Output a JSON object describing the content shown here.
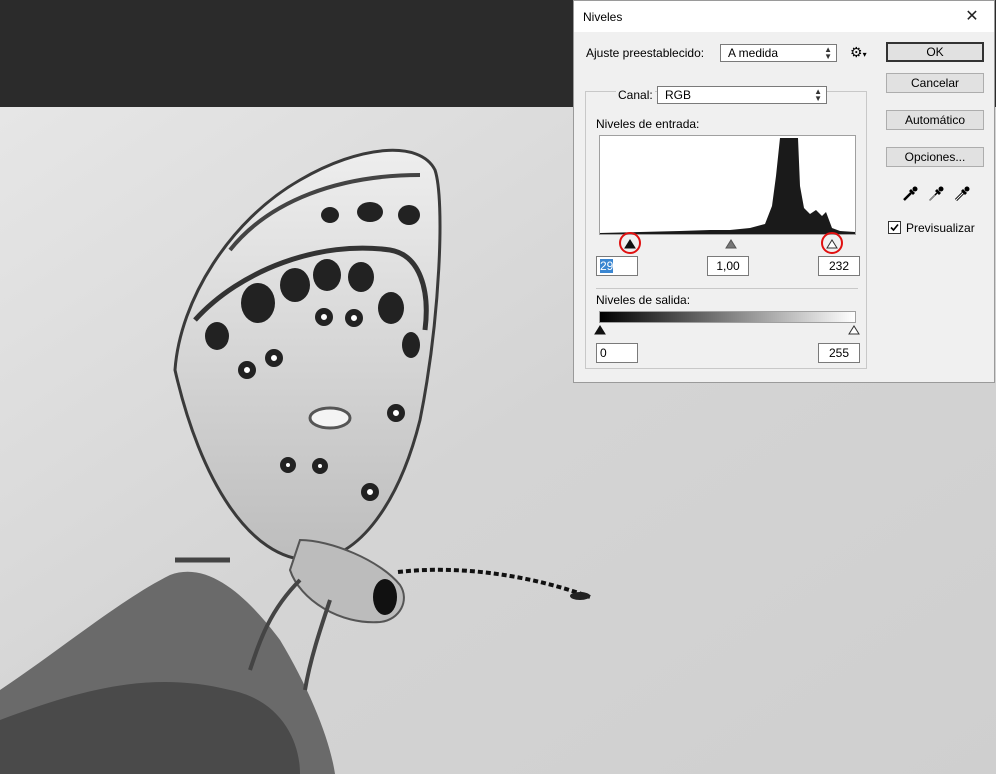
{
  "dialog": {
    "title": "Niveles",
    "preset_label": "Ajuste preestablecido:",
    "preset_value": "A medida",
    "settings_icon": "gear-icon",
    "channel_label": "Canal:",
    "channel_value": "RGB",
    "input_levels_label": "Niveles de entrada:",
    "input_black": "29",
    "input_gamma": "1,00",
    "input_white": "232",
    "input_black_level": 29,
    "input_white_level": 232,
    "output_levels_label": "Niveles de salida:",
    "output_black": "0",
    "output_white": "255",
    "output_black_level": 0,
    "output_white_level": 255,
    "buttons": {
      "ok": "OK",
      "cancel": "Cancelar",
      "auto": "Automático",
      "options": "Opciones..."
    },
    "eyedroppers": [
      "black-eyedropper-icon",
      "gray-eyedropper-icon",
      "white-eyedropper-icon"
    ],
    "preview_label": "Previsualizar",
    "preview_checked": true,
    "highlight_color": "#e01010"
  }
}
